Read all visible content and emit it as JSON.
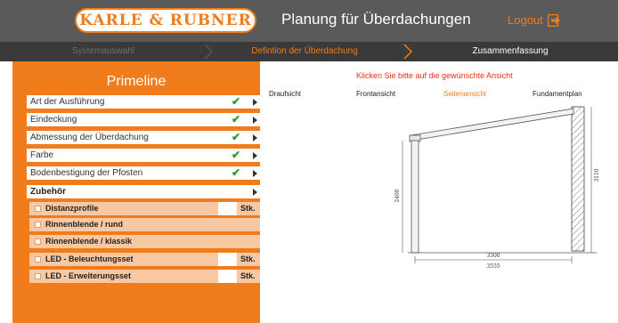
{
  "header": {
    "logo": "KARLE & RUBNER",
    "title": "Planung für Überdachungen",
    "logout_label": "Logout",
    "colors": {
      "bar": "#5a5a5a",
      "accent": "#f07c1b"
    }
  },
  "steps": [
    {
      "label": "Systemauswahl",
      "state": "done"
    },
    {
      "label": "Defintion der Überdachung",
      "state": "active"
    },
    {
      "label": "Zusammenfassung",
      "state": "upcoming"
    }
  ],
  "sidebar": {
    "title": "Primeline",
    "items": [
      {
        "label": "Art der Ausführung",
        "checked": true
      },
      {
        "label": "Eindeckung",
        "checked": true
      },
      {
        "label": "Abmessung der Überdachung",
        "checked": true
      },
      {
        "label": "Farbe",
        "checked": true
      },
      {
        "label": "Bodenbestigung der Pfosten",
        "checked": true
      },
      {
        "label": "Zubehör",
        "checked": false
      }
    ],
    "accessories": [
      {
        "label": "Distanzprofile",
        "has_qty": true,
        "unit": "Stk."
      },
      {
        "label": "Rinnenblende / rund",
        "has_qty": false,
        "unit": ""
      },
      {
        "label": "Rinnenblende / klassik",
        "has_qty": false,
        "unit": ""
      },
      {
        "label": "LED - Beleuchtungsset",
        "has_qty": true,
        "unit": "Stk."
      },
      {
        "label": "LED - Erweiterungsset",
        "has_qty": true,
        "unit": "Stk."
      }
    ]
  },
  "main": {
    "instruction": "Klicken Sie bitte auf die gewünschte Ansicht",
    "views": [
      "Draufsicht",
      "Frontansicht",
      "Seitenansicht",
      "Fundamentplan"
    ],
    "active_view": "Seitenansicht",
    "dimensions": {
      "post_height": "2400",
      "wall_height": "3110",
      "depth_inner": "3300",
      "depth_outer": "3555"
    }
  }
}
